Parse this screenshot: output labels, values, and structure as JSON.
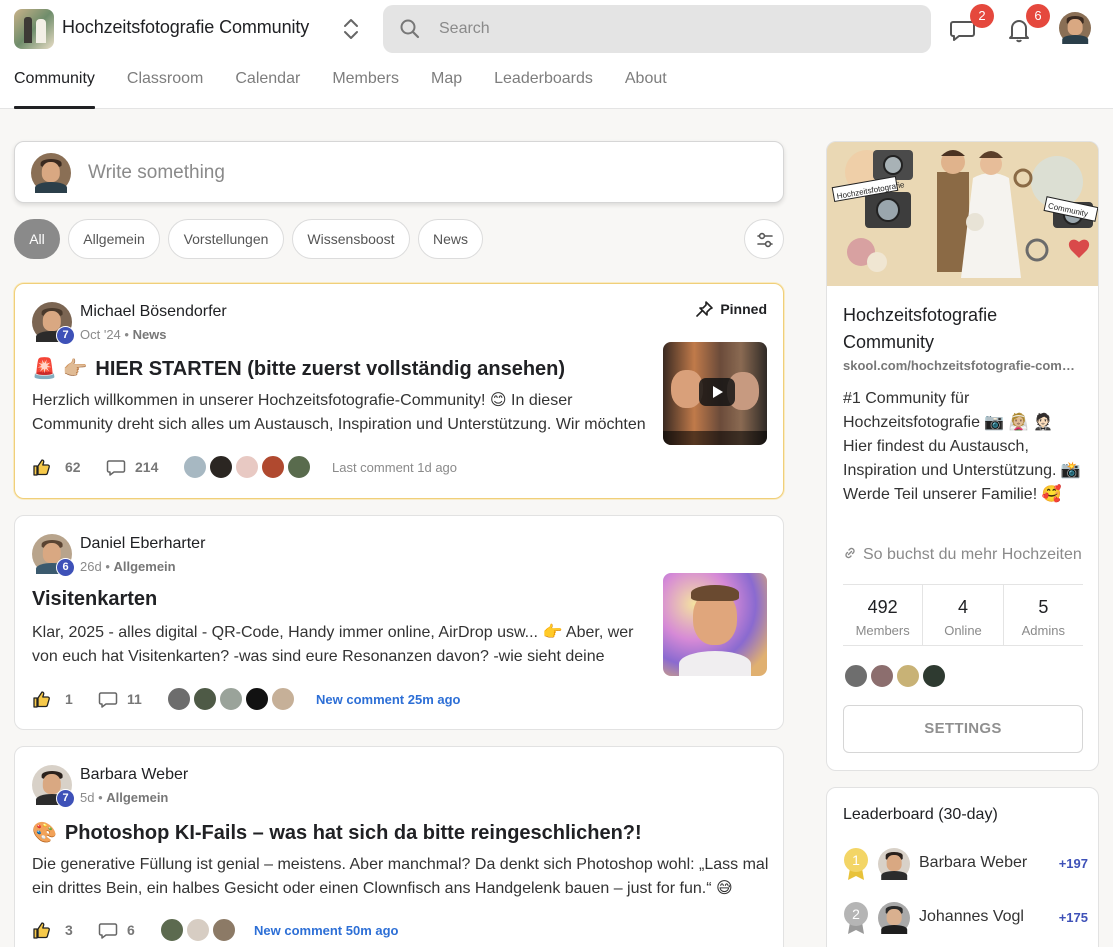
{
  "header": {
    "title": "Hochzeitsfotografie Community",
    "search_placeholder": "Search",
    "chat_badge": "2",
    "notif_badge": "6"
  },
  "nav": {
    "tabs": [
      "Community",
      "Classroom",
      "Calendar",
      "Members",
      "Map",
      "Leaderboards",
      "About"
    ],
    "active": "Community"
  },
  "composer": {
    "placeholder": "Write something"
  },
  "filters": {
    "chips": [
      "All",
      "Allgemein",
      "Vorstellungen",
      "Wissensboost",
      "News"
    ],
    "active": "All"
  },
  "posts": [
    {
      "author": "Michael Bösendorfer",
      "level": "7",
      "date": "Oct '24",
      "category": "News",
      "pinned": "Pinned",
      "title_emoji": "🚨 👉🏼",
      "title": "HIER STARTEN (bitte zuerst vollständig ansehen)",
      "body": "Herzlich willkommen in unserer Hochzeitsfotografie-Community! 😊 In dieser Community dreht sich alles um Austausch, Inspiration und Unterstützung. Wir möchten",
      "likes": "62",
      "comments": "214",
      "comment_note": "Last comment 1d ago"
    },
    {
      "author": "Daniel Eberharter",
      "level": "6",
      "date": "26d",
      "category": "Allgemein",
      "title": "Visitenkarten",
      "body": "Klar, 2025 - alles digital - QR-Code, Handy immer online, AirDrop usw... 👉 Aber, wer von euch hat Visitenkarten? -was sind eure Resonanzen davon? -wie sieht deine",
      "likes": "1",
      "comments": "11",
      "comment_note": "New comment 25m ago"
    },
    {
      "author": "Barbara Weber",
      "level": "7",
      "date": "5d",
      "category": "Allgemein",
      "title_emoji": "🎨",
      "title": "Photoshop KI-Fails – was hat sich da bitte reingeschlichen?!",
      "body": "Die generative Füllung ist genial – meistens. Aber manchmal? Da denkt sich Photoshop wohl: „Lass mal ein drittes Bein, ein halbes Gesicht oder einen Clownfisch ans Handgelenk bauen – just for fun.“ 😅",
      "likes": "3",
      "comments": "6",
      "comment_note": "New comment 50m ago"
    }
  ],
  "sidebar": {
    "title": "Hochzeitsfotografie Community",
    "url": "skool.com/hochzeitsfotografie-community",
    "description": "#1 Community für Hochzeitsfotografie 📷 👰🏼 🤵🏻 Hier findest du Austausch, Inspiration und Unterstützung. 📸 Werde Teil unserer Familie! 🥰",
    "link": "So buchst du mehr Hochzeiten",
    "stats": [
      {
        "num": "492",
        "label": "Members"
      },
      {
        "num": "4",
        "label": "Online"
      },
      {
        "num": "5",
        "label": "Admins"
      }
    ],
    "settings_label": "SETTINGS",
    "cover_words": {
      "left": "Hochzeitsfotografie",
      "right": "Community"
    }
  },
  "leaderboard": {
    "title": "Leaderboard (30-day)",
    "rows": [
      {
        "rank": "1",
        "name": "Barbara Weber",
        "points": "+197"
      },
      {
        "rank": "2",
        "name": "Johannes Vogl",
        "points": "+175"
      }
    ]
  },
  "colors": {
    "accent": "#3e51b8",
    "badge": "#e5483d",
    "link": "#2d6fd6",
    "pinned_border": "#f0cf7a"
  }
}
